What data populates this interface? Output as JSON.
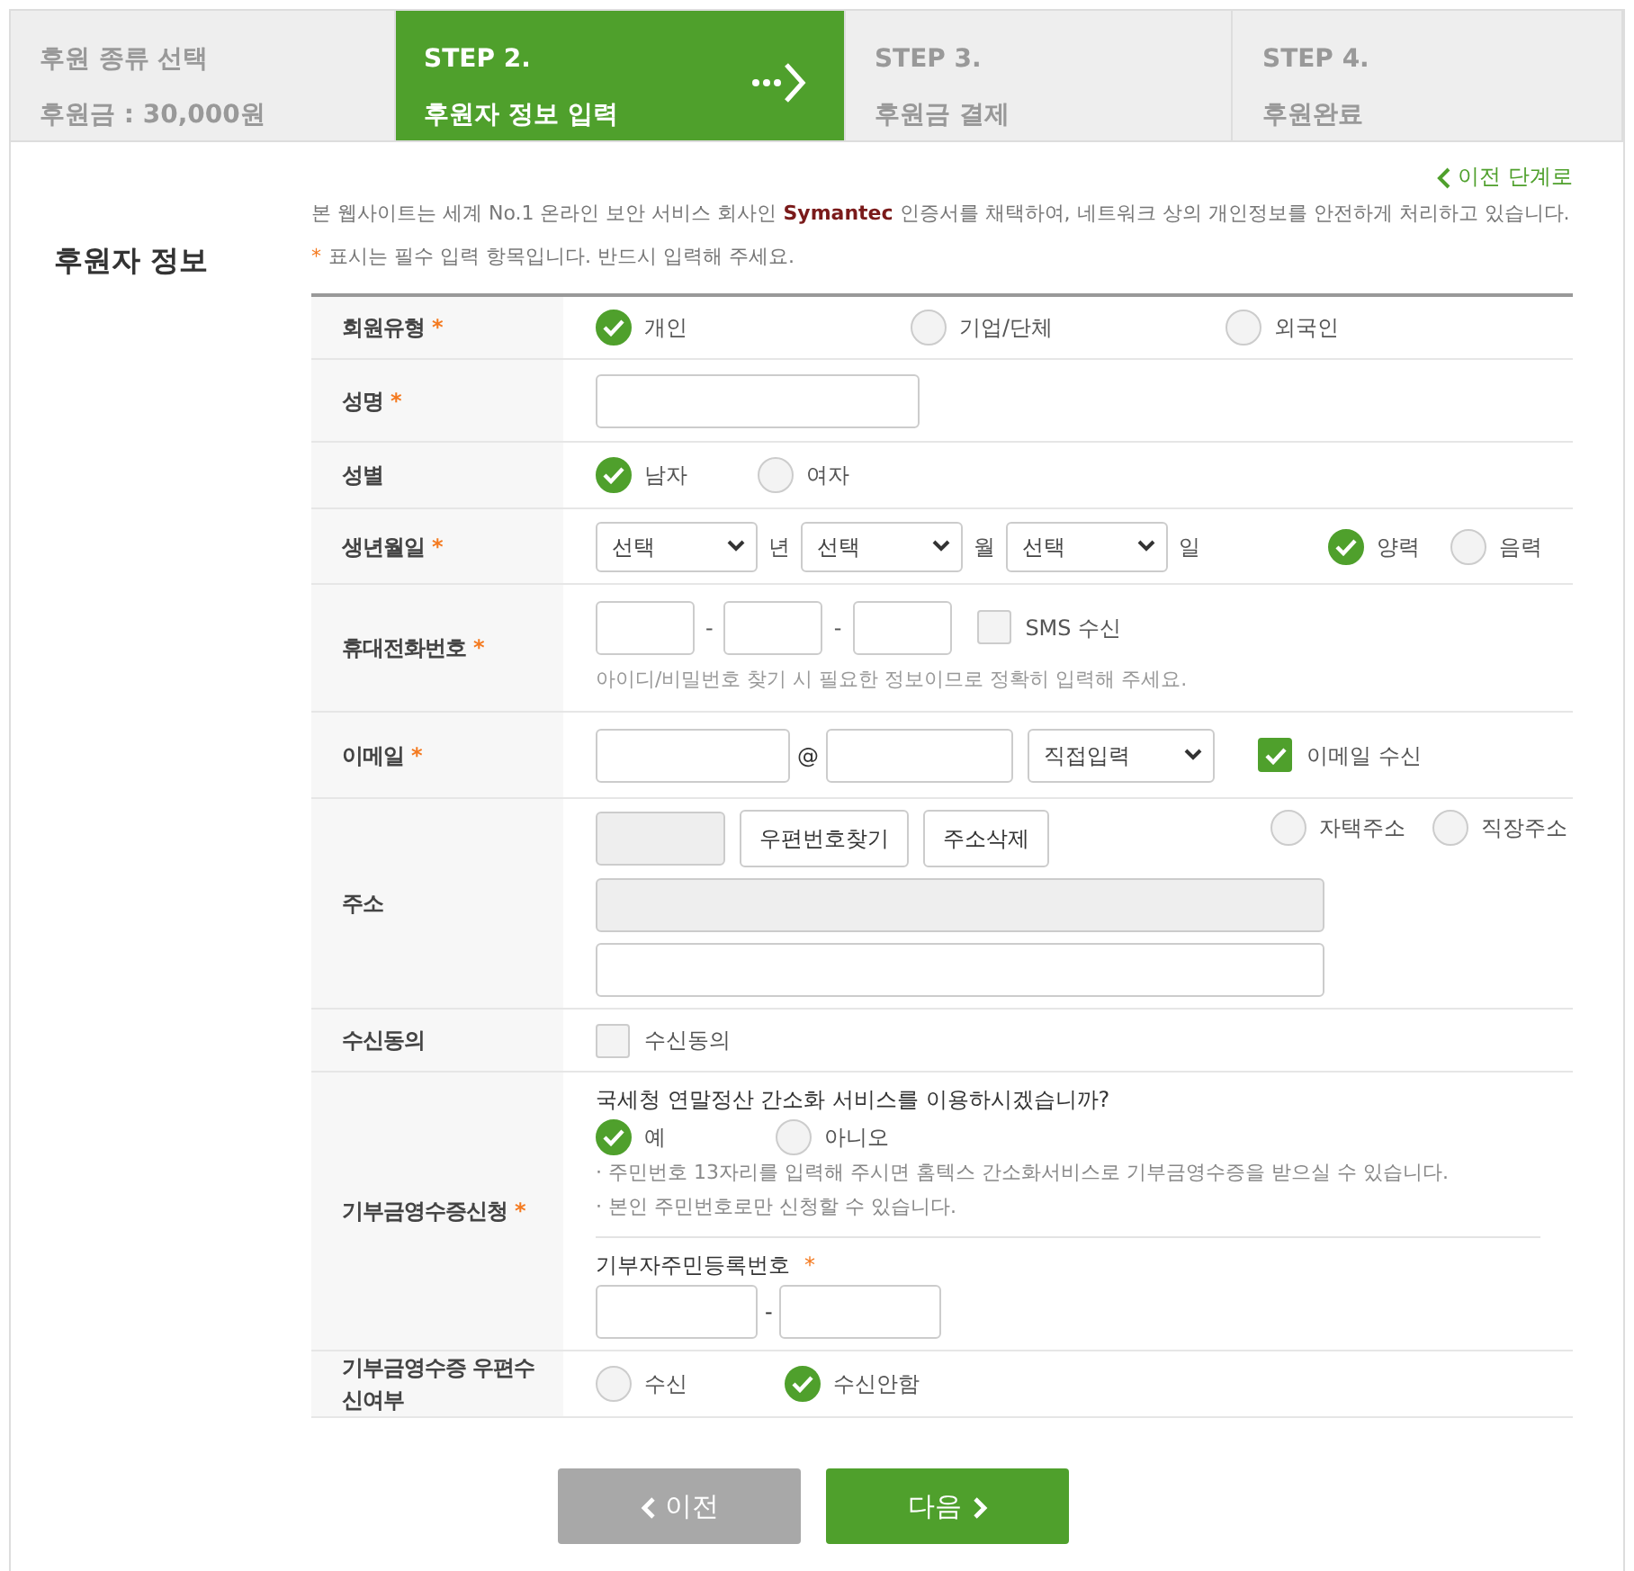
{
  "steps": [
    {
      "title": "후원 종류 선택",
      "subtitle": "후원금 : 30,000원",
      "selected": false
    },
    {
      "title": "STEP 2.",
      "subtitle": "후원자 정보 입력",
      "selected": true
    },
    {
      "title": "STEP 3.",
      "subtitle": "후원금 결제",
      "selected": false
    },
    {
      "title": "STEP 4.",
      "subtitle": "후원완료",
      "selected": false
    }
  ],
  "back_link": "이전 단계로",
  "section_title": "후원자 정보",
  "notice": "본 웹사이트는 세계 No.1 온라인 보안 서비스 회사인 **Symantec** 인증서를 채택하여, 네트워크 상의 개인정보를 안전하게 처리하고 있습니다.",
  "required_note": {
    "mark": "*",
    "text": "표시는 필수 입력 항목입니다. 반드시 입력해 주세요."
  },
  "rows": [
    {
      "label": "회원유형",
      "required": "*",
      "kind": "radios",
      "options": [
        {
          "label": "개인",
          "selected": true
        },
        {
          "label": "기업/단체",
          "selected": false
        },
        {
          "label": "외국인",
          "selected": false
        }
      ]
    },
    {
      "label": "성명",
      "required": "*",
      "kind": "text"
    },
    {
      "label": "성별",
      "kind": "radios",
      "options": [
        {
          "label": "남자",
          "selected": true
        },
        {
          "label": "여자",
          "selected": false
        }
      ]
    },
    {
      "label": "생년월일",
      "required": "*",
      "kind": "date",
      "selects": [
        {
          "value": "선택",
          "unit": "년"
        },
        {
          "value": "선택",
          "unit": "월"
        },
        {
          "value": "선택",
          "unit": "일"
        }
      ],
      "options": [
        {
          "label": "양력",
          "selected": true
        },
        {
          "label": "음력",
          "selected": false
        }
      ]
    },
    {
      "label": "휴대전화번호",
      "required": "*",
      "kind": "phone",
      "separators": [
        "-",
        "-"
      ],
      "checkbox": {
        "label": "SMS 수신",
        "checked": false
      },
      "hint": "아이디/비밀번호 찾기 시 필요한 정보이므로 정확히 입력해 주세요."
    },
    {
      "label": "이메일",
      "required": "*",
      "kind": "email",
      "at": "@",
      "select": "직접입력",
      "checkbox": {
        "label": "이메일 수신",
        "checked": true
      }
    },
    {
      "label": "주소",
      "kind": "address",
      "buttons": [
        "우편번호찾기",
        "주소삭제"
      ],
      "options": [
        {
          "label": "자택주소",
          "selected": false
        },
        {
          "label": "직장주소",
          "selected": false
        }
      ]
    },
    {
      "label": "수신동의",
      "kind": "check",
      "checkbox": {
        "label": "수신동의",
        "checked": false
      }
    },
    {
      "label": "기부금영수증신청",
      "required": "*",
      "kind": "receipt",
      "question": "국세청 연말정산 간소화 서비스를 이용하시겠습니까?",
      "options": [
        {
          "label": "예",
          "selected": true
        },
        {
          "label": "아니오",
          "selected": false
        }
      ],
      "notes": [
        "· 주민번호 13자리를 입력해 주시면 홈텍스 간소화서비스로 기부금영수증을 받으실 수 있습니다.",
        "· 본인 주민번호로만 신청할 수 있습니다."
      ],
      "id_label": "기부자주민등록번호",
      "id_required": "*",
      "separator": "-"
    },
    {
      "label": "기부금영수증 우편수신여부",
      "kind": "radios",
      "options": [
        {
          "label": "수신",
          "selected": false
        },
        {
          "label": "수신안함",
          "selected": true
        }
      ]
    }
  ],
  "buttons": [
    {
      "label": "이전",
      "kind": "prev"
    },
    {
      "label": "다음",
      "kind": "next"
    }
  ]
}
